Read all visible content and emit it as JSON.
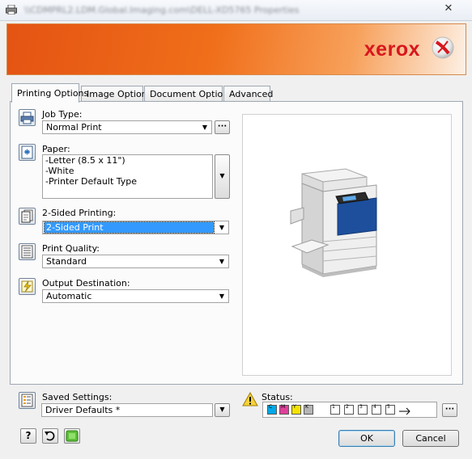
{
  "window": {
    "title": "\\\\CDMPRL2.LDM.Global.Imaging.com\\DELL-XD5765 Properties",
    "close_glyph": "✕"
  },
  "brand": {
    "wordmark": "xerox",
    "logo_icon": "xerox-sphere-logo"
  },
  "tabs": [
    {
      "label": "Printing Options",
      "active": true
    },
    {
      "label": "Image Options",
      "active": false
    },
    {
      "label": "Document Options",
      "active": false
    },
    {
      "label": "Advanced",
      "active": false
    }
  ],
  "settings": {
    "job_type": {
      "label": "Job Type:",
      "value": "Normal Print",
      "more_label": "···",
      "icon": "job-type-icon"
    },
    "paper": {
      "label": "Paper:",
      "lines": [
        "-Letter (8.5 x 11\")",
        "-White",
        "-Printer Default Type"
      ],
      "icon": "paper-icon"
    },
    "two_sided": {
      "label": "2-Sided Printing:",
      "value": "2-Sided Print",
      "icon": "two-sided-icon"
    },
    "print_quality": {
      "label": "Print Quality:",
      "value": "Standard",
      "icon": "print-quality-icon"
    },
    "output_destination": {
      "label": "Output Destination:",
      "value": "Automatic",
      "icon": "output-destination-icon"
    }
  },
  "saved_settings": {
    "label": "Saved Settings:",
    "value": "Driver Defaults *",
    "icon": "saved-settings-icon"
  },
  "status": {
    "label": "Status:",
    "warning_icon": "warning-icon",
    "more_label": "···",
    "toner": [
      {
        "letter": "C",
        "color": "#00a8e8"
      },
      {
        "letter": "M",
        "color": "#e0409a"
      },
      {
        "letter": "Y",
        "color": "#f5e400"
      },
      {
        "letter": "K",
        "color": "#222222"
      }
    ],
    "trays": [
      "1",
      "2",
      "3",
      "4",
      "5"
    ]
  },
  "bottom_buttons": {
    "help_label": "?",
    "ok_label": "OK",
    "cancel_label": "Cancel"
  },
  "colors": {
    "banner_orange": "#e45313",
    "xerox_red": "#d8171d",
    "printer_blue": "#1d4f9c",
    "selection_blue": "#3399ff"
  }
}
